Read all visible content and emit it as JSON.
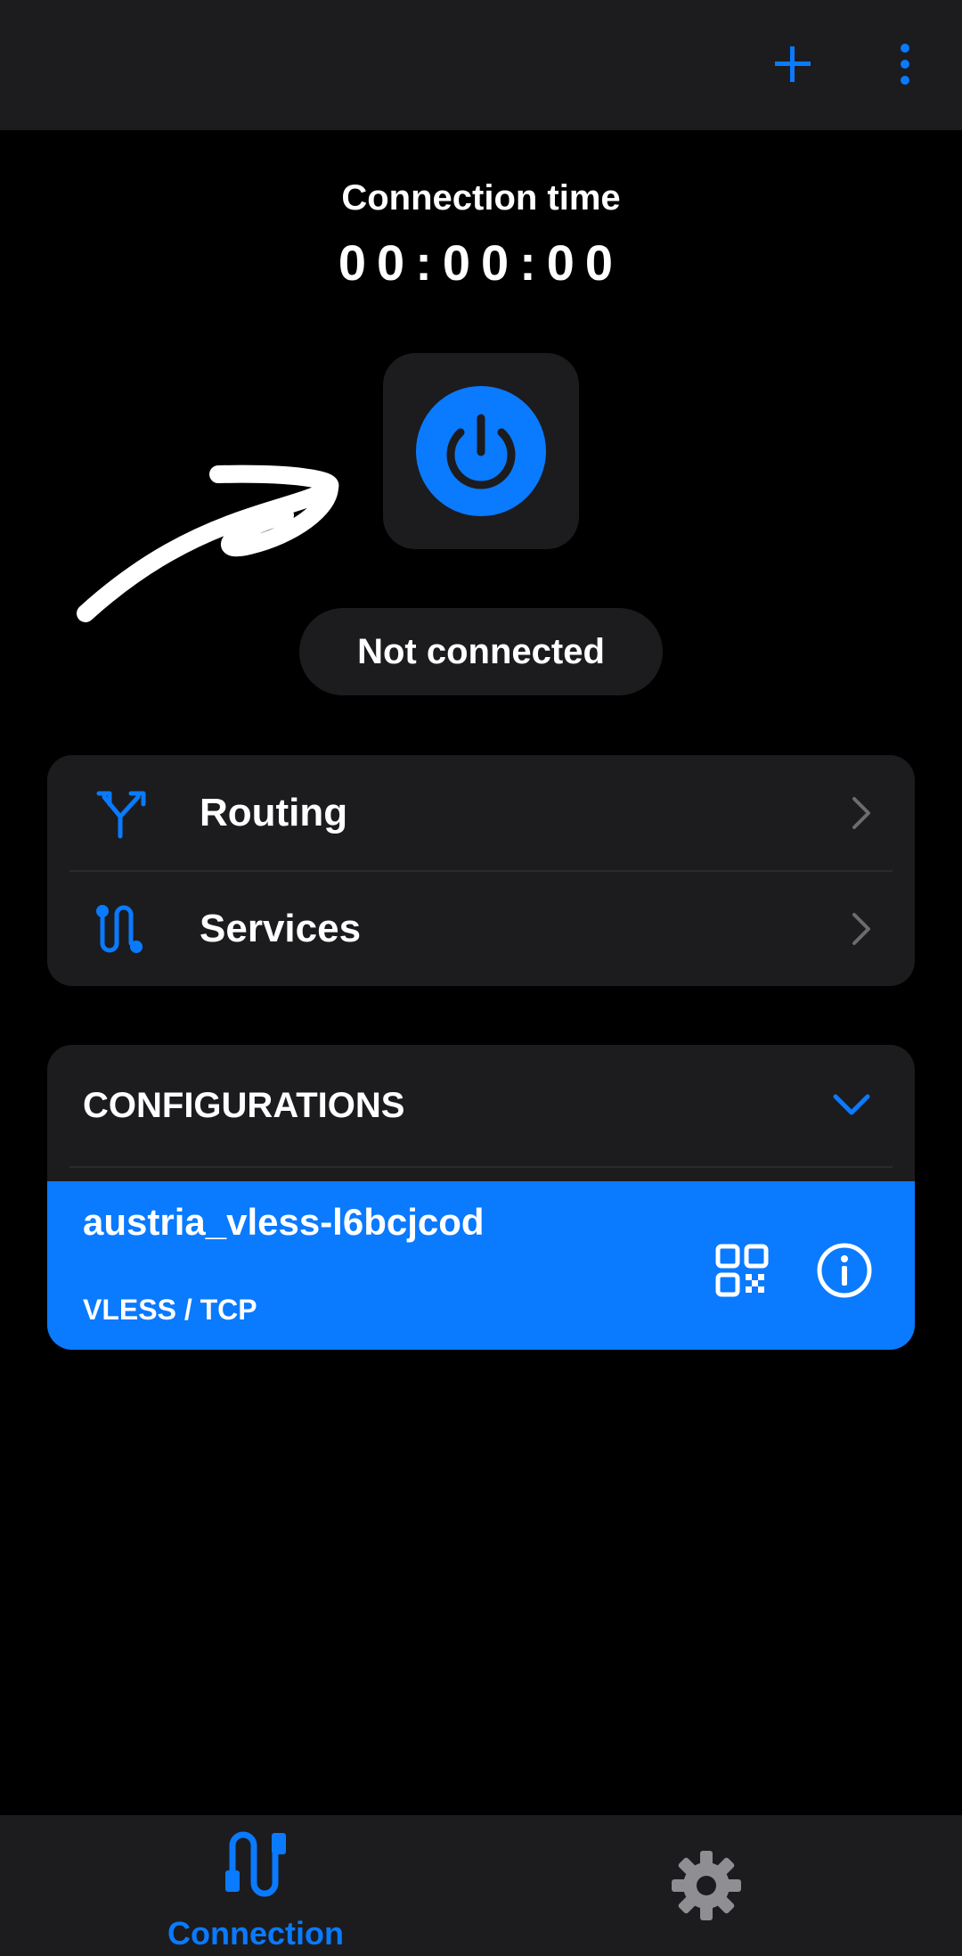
{
  "topbar": {
    "add_icon": "plus-icon",
    "menu_icon": "more-vertical-icon"
  },
  "timer": {
    "label": "Connection time",
    "value": "00:00:00"
  },
  "power": {
    "icon": "power-icon",
    "color": "#0a7aff"
  },
  "status": {
    "label": "Not connected"
  },
  "menu": {
    "items": [
      {
        "label": "Routing",
        "icon": "routing-split-icon"
      },
      {
        "label": "Services",
        "icon": "services-path-icon"
      }
    ]
  },
  "configurations": {
    "title": "CONFIGURATIONS",
    "toggle_icon": "chevron-down-icon",
    "items": [
      {
        "name": "austria_vless-l6bcjcod",
        "protocol": "VLESS / TCP"
      }
    ]
  },
  "bottom_nav": {
    "items": [
      {
        "label": "Connection",
        "icon": "connection-plug-icon",
        "active": true
      },
      {
        "label": "",
        "icon": "settings-gear-icon",
        "active": false
      }
    ]
  },
  "colors": {
    "accent": "#0a7aff",
    "surface": "#1c1c1e",
    "background": "#000000"
  }
}
